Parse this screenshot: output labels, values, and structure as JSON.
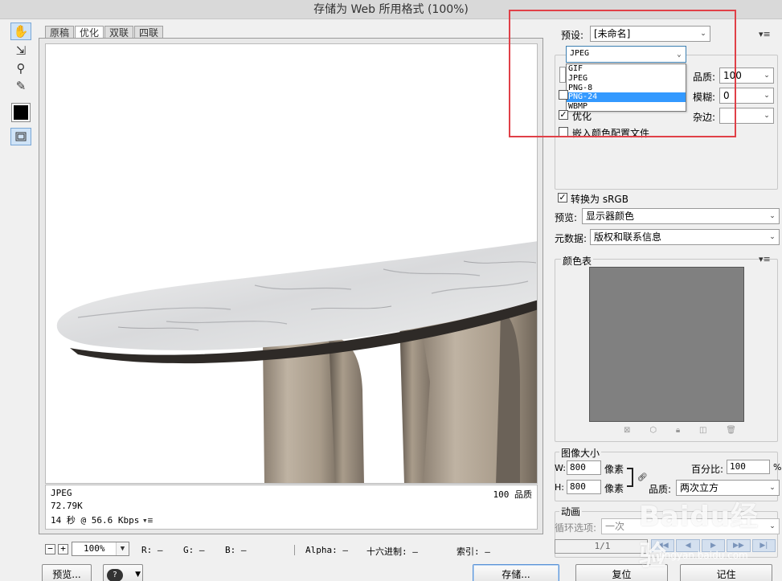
{
  "window": {
    "title": "存储为 Web 所用格式 (100%)"
  },
  "toolbox": {
    "tools": [
      {
        "name": "hand-tool",
        "icon": "hand-icon",
        "glyph": "✋"
      },
      {
        "name": "slice-select-tool",
        "icon": "slice-select-icon",
        "glyph": "⇲"
      },
      {
        "name": "zoom-tool",
        "icon": "magnifier-icon",
        "glyph": "⚲"
      },
      {
        "name": "eyedropper-tool",
        "icon": "eyedropper-icon",
        "glyph": "✎"
      }
    ],
    "eyedropper_color": "#000000"
  },
  "tabs": [
    {
      "label": "原稿",
      "active": false
    },
    {
      "label": "优化",
      "active": true
    },
    {
      "label": "双联",
      "active": false
    },
    {
      "label": "四联",
      "active": false
    }
  ],
  "image_info": {
    "format": "JPEG",
    "size": "72.79K",
    "download_time": "14 秒 @ 56.6 Kbps",
    "quality": "100 品质"
  },
  "status_bar": {
    "zoom": "100%",
    "r_label": "R:",
    "r_value": "—",
    "g_label": "G:",
    "g_value": "—",
    "b_label": "B:",
    "b_value": "—",
    "alpha_label": "Alpha:",
    "alpha_value": "—",
    "hex_label": "十六进制:",
    "hex_value": "—",
    "index_label": "索引:",
    "index_value": "—"
  },
  "buttons": {
    "preview": "预览...",
    "save": "存储...",
    "reset": "复位",
    "remember": "记住"
  },
  "settings": {
    "preset_label": "预设:",
    "preset_value": "[未命名]",
    "format_value": "JPEG",
    "format_options": [
      "GIF",
      "JPEG",
      "PNG-8",
      "PNG-24",
      "WBMP"
    ],
    "format_selected_index": 3,
    "quality_label": "品质:",
    "quality_value": "100",
    "blur_label": "模糊:",
    "blur_value": "0",
    "matte_label": "杂边:",
    "optimize_label": "优化",
    "optimize_checked": true,
    "embed_profile_label": "嵌入颜色配置文件",
    "embed_profile_checked": false,
    "convert_srgb_label": "转换为 sRGB",
    "convert_srgb_checked": true,
    "preview_label": "预览:",
    "preview_value": "显示器颜色",
    "metadata_label": "元数据:",
    "metadata_value": "版权和联系信息"
  },
  "color_table": {
    "title": "颜色表",
    "fill": "#808080"
  },
  "image_size": {
    "title": "图像大小",
    "w_label": "W:",
    "w_value": "800",
    "h_label": "H:",
    "h_value": "800",
    "unit": "像素",
    "percent_label": "百分比:",
    "percent_value": "100",
    "percent_unit": "%",
    "quality_label": "品质:",
    "quality_value": "两次立方"
  },
  "animation": {
    "title": "动画",
    "loop_label": "循环选项:",
    "loop_value": "一次",
    "frame_counter": "1/1"
  },
  "watermark": {
    "text": "Baidu经验",
    "sub": "jingyan.baidu.com"
  },
  "colors": {
    "highlight": "#e04048",
    "selection": "#3399ff"
  }
}
